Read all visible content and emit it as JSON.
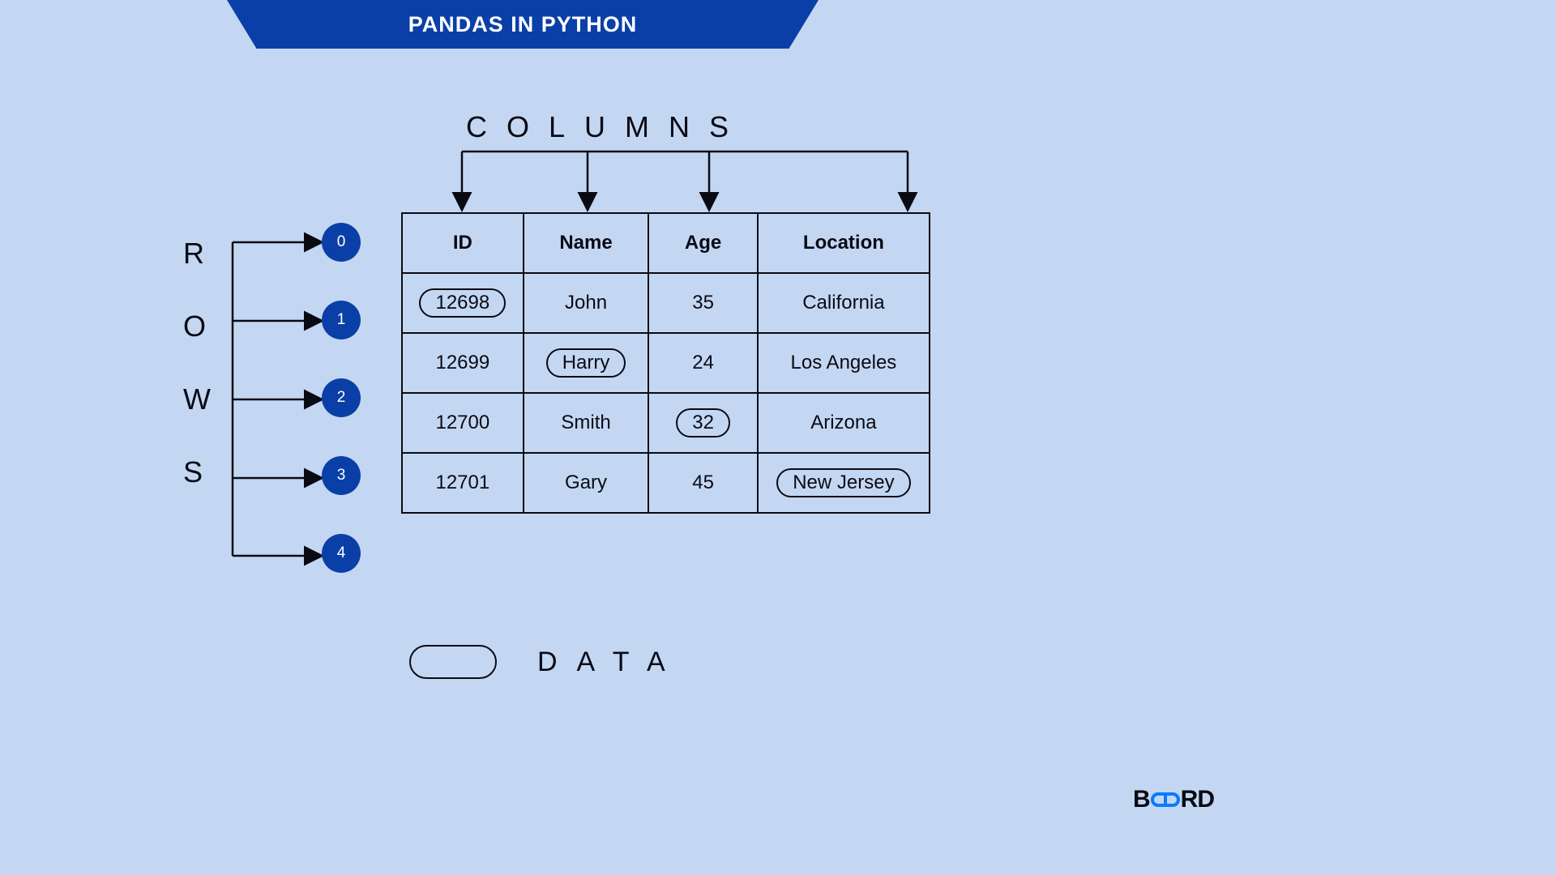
{
  "banner": {
    "title": "PANDAS IN PYTHON"
  },
  "labels": {
    "columns": "COLUMNS",
    "rows_letters": [
      "R",
      "O",
      "W",
      "S"
    ],
    "data": "DATA"
  },
  "indices": [
    "0",
    "1",
    "2",
    "3",
    "4"
  ],
  "headers": {
    "id": "ID",
    "name": "Name",
    "age": "Age",
    "location": "Location"
  },
  "rows": [
    {
      "id": "12698",
      "name": "John",
      "age": "35",
      "location": "California"
    },
    {
      "id": "12699",
      "name": "Harry",
      "age": "24",
      "location": "Los Angeles"
    },
    {
      "id": "12700",
      "name": "Smith",
      "age": "32",
      "location": "Arizona"
    },
    {
      "id": "12701",
      "name": "Gary",
      "age": "45",
      "location": "New Jersey"
    }
  ],
  "brand": {
    "pre": "B",
    "post": "RD"
  }
}
